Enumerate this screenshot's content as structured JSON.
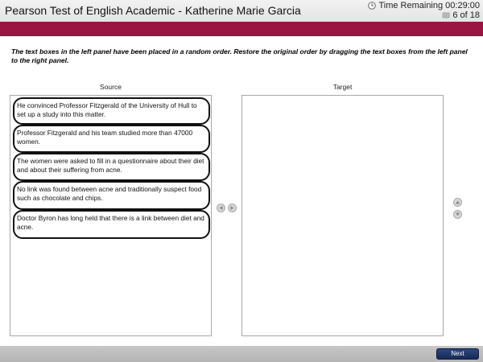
{
  "header": {
    "title": "Pearson Test of English Academic - Katherine Marie Garcia",
    "time_remaining": "Time Remaining 00:29:00",
    "page_count": "6 of 18"
  },
  "instructions": "The text boxes in the left panel have been placed in a random order. Restore the original order by dragging the text boxes from the left panel to the right panel.",
  "source": {
    "label": "Source",
    "items": [
      "He convinced Professor Fitzgerald of the University of Hull to set up a study into this matter.",
      "Professor Fitzgerald and his team studied more than 47000 women.",
      "The women were asked to fill in a questionnaire about their diet and about their suffering from acne.",
      "No link was found between acne and traditionally suspect food such as chocolate and chips.",
      "Doctor Byron has long held that there is a link between diet and acne."
    ]
  },
  "target": {
    "label": "Target",
    "items": []
  },
  "footer": {
    "next_label": "Next"
  },
  "colors": {
    "brand_band": "#9b1543",
    "next_button": "#1f3466"
  }
}
